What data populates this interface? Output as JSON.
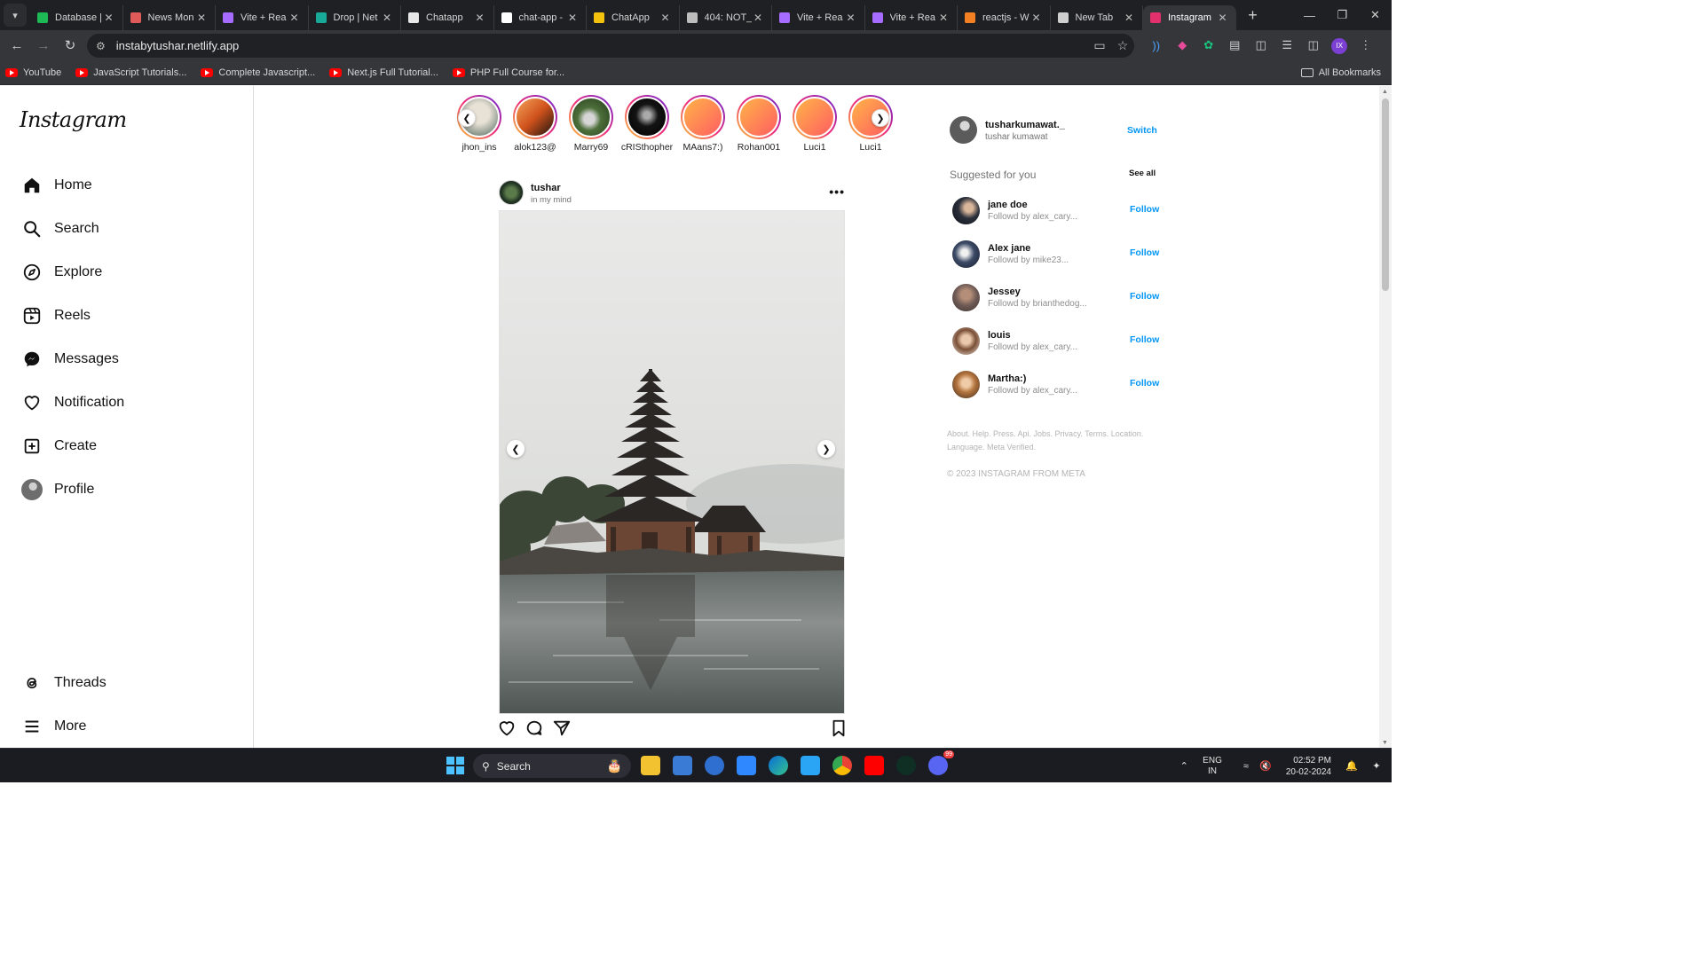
{
  "browser": {
    "tabs": [
      {
        "label": "Database |",
        "color": "#1db954"
      },
      {
        "label": "News Mon",
        "color": "#e05a5a"
      },
      {
        "label": "Vite + Rea",
        "color": "#a56cff"
      },
      {
        "label": "Drop | Net",
        "color": "#18a999"
      },
      {
        "label": "Chatapp",
        "color": "#e8e8e8"
      },
      {
        "label": "chat-app -",
        "color": "#ffffff"
      },
      {
        "label": "ChatApp",
        "color": "#f4c20d"
      },
      {
        "label": "404: NOT_",
        "color": "#bdbdbd"
      },
      {
        "label": "Vite + Rea",
        "color": "#a56cff"
      },
      {
        "label": "Vite + Rea",
        "color": "#a56cff"
      },
      {
        "label": "reactjs - W",
        "color": "#f48024"
      },
      {
        "label": "New Tab",
        "color": "#cfcfcf"
      },
      {
        "label": "Instagram",
        "color": "#e1306c"
      }
    ],
    "active_tab_index": 12,
    "url": "instabytushar.netlify.app",
    "bookmarks": [
      "YouTube",
      "JavaScript Tutorials...",
      "Complete Javascript...",
      "Next.js Full Tutorial...",
      "PHP Full Course for..."
    ],
    "all_bookmarks_label": "All Bookmarks",
    "profile_initials": "IX"
  },
  "sidebar": {
    "logo": "Instagram",
    "items": [
      {
        "label": "Home",
        "icon": "home-icon"
      },
      {
        "label": "Search",
        "icon": "search-icon"
      },
      {
        "label": "Explore",
        "icon": "compass-icon"
      },
      {
        "label": "Reels",
        "icon": "reels-icon"
      },
      {
        "label": "Messages",
        "icon": "messenger-icon"
      },
      {
        "label": "Notification",
        "icon": "heart-icon"
      },
      {
        "label": "Create",
        "icon": "plus-square-icon"
      },
      {
        "label": "Profile",
        "icon": "profile-avatar"
      }
    ],
    "bottom_items": [
      {
        "label": "Threads",
        "icon": "threads-icon"
      },
      {
        "label": "More",
        "icon": "hamburger-icon"
      }
    ]
  },
  "stories": [
    {
      "user": "jhon_ins",
      "bg": "radial-gradient(circle at 50% 40%, #e8e1d6 0 35%, #7a8a7f 80%)"
    },
    {
      "user": "alok123@",
      "bg": "linear-gradient(135deg, #f3a35b, #d0521c, #1c1410)"
    },
    {
      "user": "Marry69",
      "bg": "radial-gradient(circle at 45% 55%, #d6d6d6 0 18%, #4d6f3a 40%, #263b1c 100%)"
    },
    {
      "user": "cRISthopher",
      "bg": "radial-gradient(circle at 50% 45%, #aaaaaa 0 12%, #141414 40%, #000 100%)"
    },
    {
      "user": "MAans7:)",
      "bg": "linear-gradient(135deg, #ffb347, #ff5e62)"
    },
    {
      "user": "Rohan001",
      "bg": "linear-gradient(135deg, #ffb347, #ff5e62)"
    },
    {
      "user": "Luci1",
      "bg": "linear-gradient(135deg, #ffb347, #ff5e62)"
    },
    {
      "user": "Luci1",
      "bg": "linear-gradient(135deg, #ffb347, #ff5e62)"
    }
  ],
  "post": {
    "username": "tushar",
    "location": "in my mind",
    "more": "•••"
  },
  "current_user": {
    "username": "tusharkumawat._",
    "name": "tushar kumawat",
    "action": "Switch"
  },
  "suggestions": {
    "title": "Suggested for you",
    "see_all": "See all",
    "items": [
      {
        "name": "jane doe",
        "sub": "Followd by alex_cary...",
        "action": "Follow",
        "bg": "radial-gradient(circle at 60% 40%, #d9b59a 0 18%, #2a2f3a 45%, #0e1118 100%)"
      },
      {
        "name": "Alex jane",
        "sub": "Followd by mike23...",
        "action": "Follow",
        "bg": "radial-gradient(circle at 45% 45%, #f1f1f1 0 15%, #3c4a66 45%, #141a2a 100%)"
      },
      {
        "name": "Jessey",
        "sub": "Followd by brianthedog...",
        "action": "Follow",
        "bg": "radial-gradient(circle at 50% 40%, #b48e78 0 22%, #6f5b56 50%, #3d3230 100%)"
      },
      {
        "name": "louis",
        "sub": "Followd by alex_cary...",
        "action": "Follow",
        "bg": "radial-gradient(circle at 50% 45%, #e9c8ab 0 22%, #7a4f36 48%, #efe8e1 100%)"
      },
      {
        "name": "Martha:)",
        "sub": "Followd by alex_cary...",
        "action": "Follow",
        "bg": "radial-gradient(circle at 50% 45%, #f0cba7 0 20%, #b4743e 45%, #3a2a1e 100%)"
      }
    ]
  },
  "footer": {
    "links": "About. Help. Press. Api. Jobs. Privacy. Terms. Location. Language. Meta Verified.",
    "copyright": "© 2023 INSTAGRAM FROM META"
  },
  "taskbar": {
    "search_label": "Search",
    "lang_top": "ENG",
    "lang_bottom": "IN",
    "time": "02:52 PM",
    "date": "20-02-2024",
    "discord_badge": "99"
  }
}
